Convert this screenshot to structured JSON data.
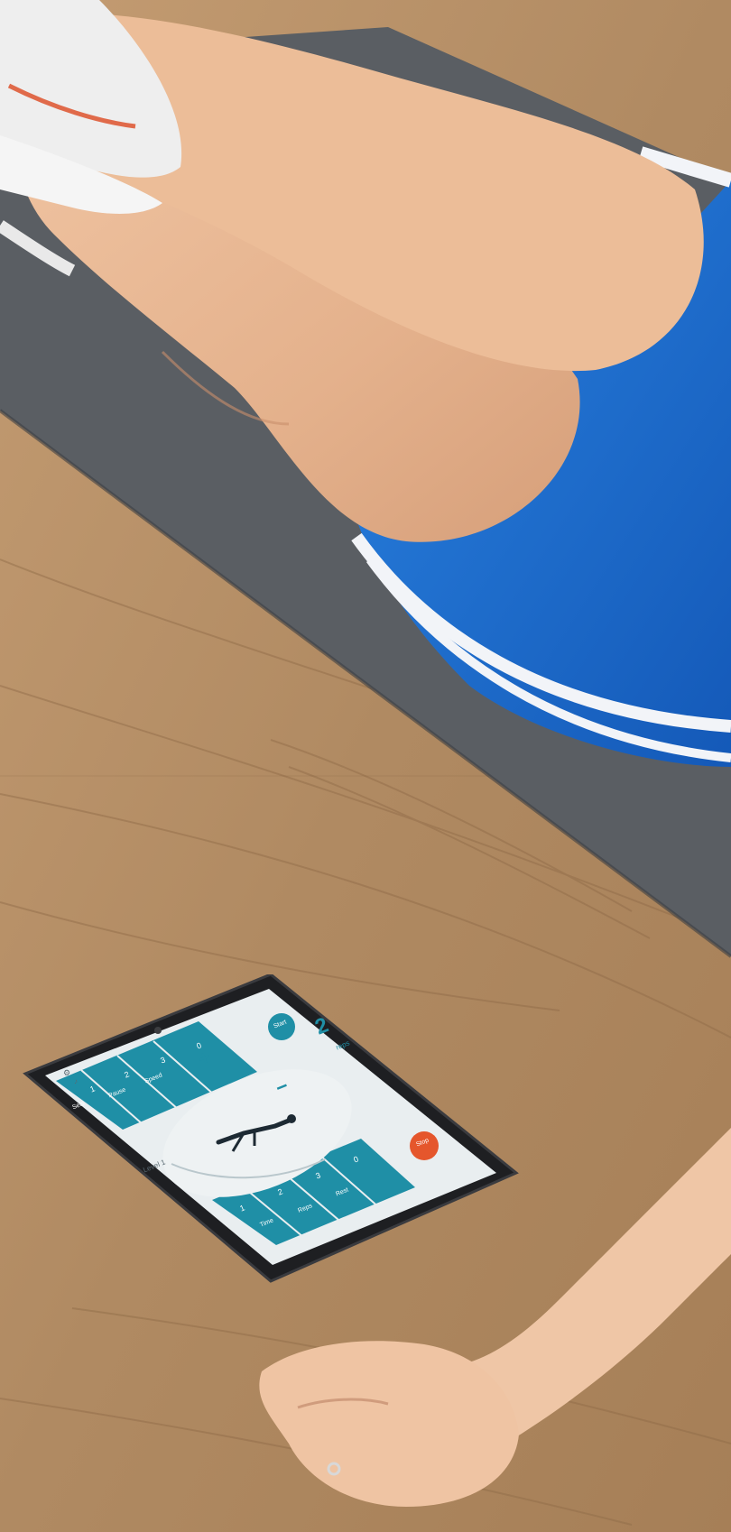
{
  "photo": {
    "subject": "person doing leg raises on mat beside tablet",
    "colors": {
      "floor": "#b08a62",
      "floor_dark": "#8a6644",
      "mat": "#5a5e63",
      "skin": "#e8b896",
      "shorts": "#1a6fd1",
      "stripe": "#f2f4f8",
      "tablet_frame": "#1e1f22",
      "screen_bg": "#e9eef0",
      "teal": "#1f8fa6",
      "stop_red": "#e5562c"
    }
  },
  "tablet_app": {
    "reps_value": "2",
    "reps_unit": "reps",
    "plus_label": "+",
    "minus_label": "−",
    "stop_label": "Stop",
    "top_button_label": "Start",
    "level_label": "Level 1",
    "left_panel_numbers": [
      "1",
      "2",
      "3",
      "0"
    ],
    "right_panel_numbers": [
      "1",
      "2",
      "3",
      "0"
    ],
    "left_panel_words": [
      "Sets",
      "Pause",
      "Speed"
    ],
    "right_panel_words": [
      "Time",
      "Reps",
      "Rest"
    ],
    "icons": [
      "gear-icon",
      "sound-icon",
      "figure-icon"
    ]
  }
}
